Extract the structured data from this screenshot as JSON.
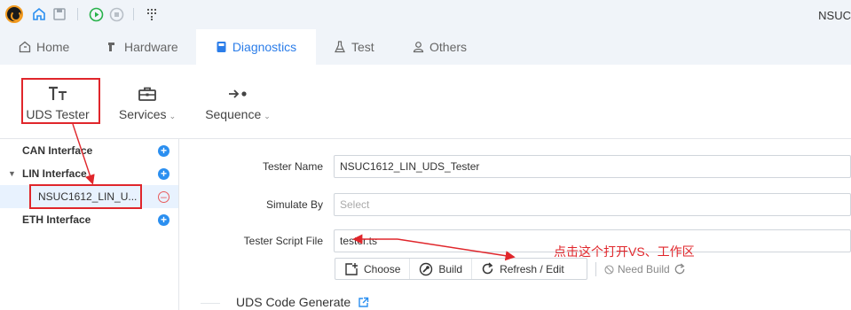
{
  "window": {
    "title": "NSUC"
  },
  "tabs": [
    {
      "label": "Home",
      "icon": "home-icon"
    },
    {
      "label": "Hardware",
      "icon": "hardware-icon"
    },
    {
      "label": "Diagnostics",
      "icon": "diagnostics-icon",
      "active": true
    },
    {
      "label": "Test",
      "icon": "flask-icon"
    },
    {
      "label": "Others",
      "icon": "user-icon"
    }
  ],
  "ribbon": {
    "uds_tester": "UDS Tester",
    "services": "Services",
    "sequence": "Sequence"
  },
  "tree": {
    "can": "CAN Interface",
    "lin": "LIN Interface",
    "lin_child": "NSUC1612_LIN_U...",
    "eth": "ETH Interface"
  },
  "form": {
    "tester_name_label": "Tester Name",
    "tester_name_value": "NSUC1612_LIN_UDS_Tester",
    "simulate_by_label": "Simulate By",
    "simulate_by_placeholder": "Select",
    "script_file_label": "Tester Script File",
    "script_file_value": "tester.ts",
    "choose": "Choose",
    "build": "Build",
    "refresh_edit": "Refresh / Edit",
    "need_build": "Need Build"
  },
  "annotation": "点击这个打开VS、工作区",
  "section": {
    "uds_code_generate": "UDS Code Generate"
  },
  "colors": {
    "accent": "#2b7de9",
    "highlight": "#e0262b",
    "selected_row": "#e8f2fe"
  }
}
